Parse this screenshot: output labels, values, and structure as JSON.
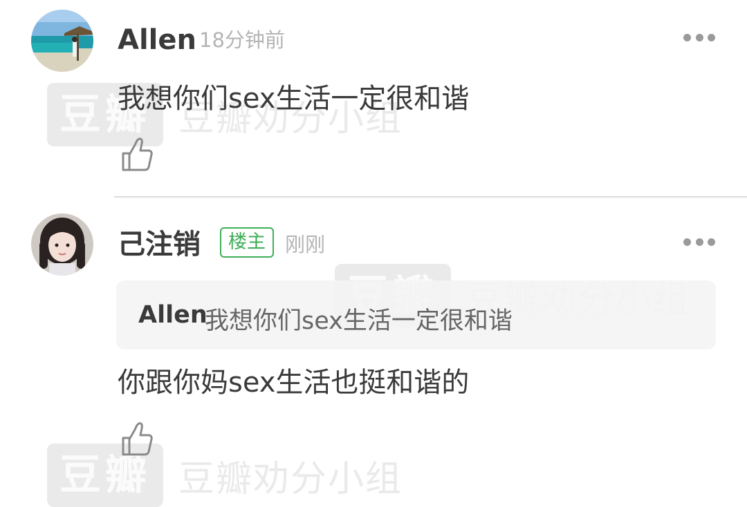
{
  "watermarks": [
    {
      "badge": "豆瓣",
      "text": "豆瓣劝分小组"
    },
    {
      "badge": "豆瓣",
      "text": "豆瓣劝分小组"
    },
    {
      "badge": "豆瓣",
      "text": "豆瓣劝分小组"
    }
  ],
  "comments": [
    {
      "author": "Allen",
      "time": "18分钟前",
      "content": "我想你们sex生活一定很和谐"
    },
    {
      "author": "己注销",
      "badge": "楼主",
      "time": "刚刚",
      "quote": {
        "author": "Allen",
        "text": "我想你们sex生活一定很和谐"
      },
      "content": "你跟你妈sex生活也挺和谐的"
    }
  ],
  "icons": {
    "more": "more-dots-icon",
    "like": "thumbs-up-icon"
  },
  "colors": {
    "owner_badge": "#3dae56",
    "text": "#3a3a3a",
    "muted": "#b4b4b4"
  }
}
